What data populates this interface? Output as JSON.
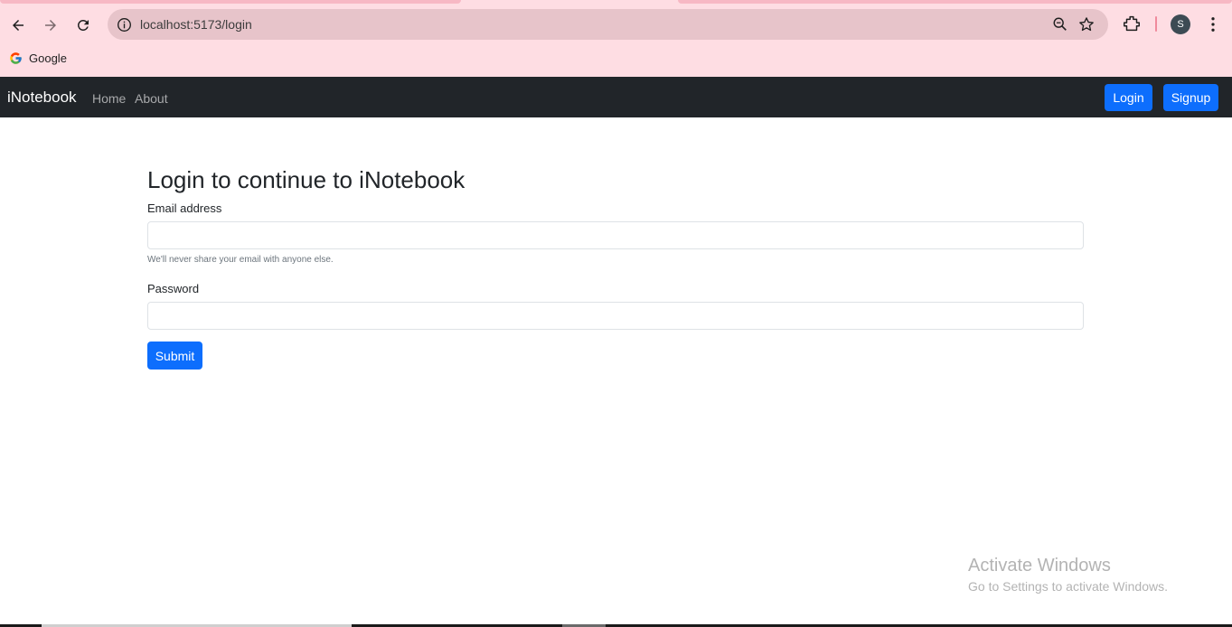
{
  "browser": {
    "url": "localhost:5173/login",
    "profile_initial": "S",
    "bookmarks": [
      {
        "label": "Google"
      }
    ],
    "accent": "#fedde3"
  },
  "navbar": {
    "brand": "iNotebook",
    "links": [
      "Home",
      "About"
    ],
    "login_label": "Login",
    "signup_label": "Signup"
  },
  "form": {
    "heading": "Login to continue to iNotebook",
    "email_label": "Email address",
    "email_value": "",
    "email_help": "We'll never share your email with anyone else.",
    "password_label": "Password",
    "password_value": "",
    "submit_label": "Submit"
  },
  "watermark": {
    "title": "Activate Windows",
    "subtitle": "Go to Settings to activate Windows."
  },
  "colors": {
    "primary": "#0d6efd",
    "navbar_bg": "#212529"
  },
  "icons": [
    "back-arrow-icon",
    "forward-arrow-icon",
    "reload-icon",
    "site-info-icon",
    "zoom-icon",
    "star-icon",
    "extensions-icon",
    "more-vert-icon",
    "google-logo-icon"
  ]
}
